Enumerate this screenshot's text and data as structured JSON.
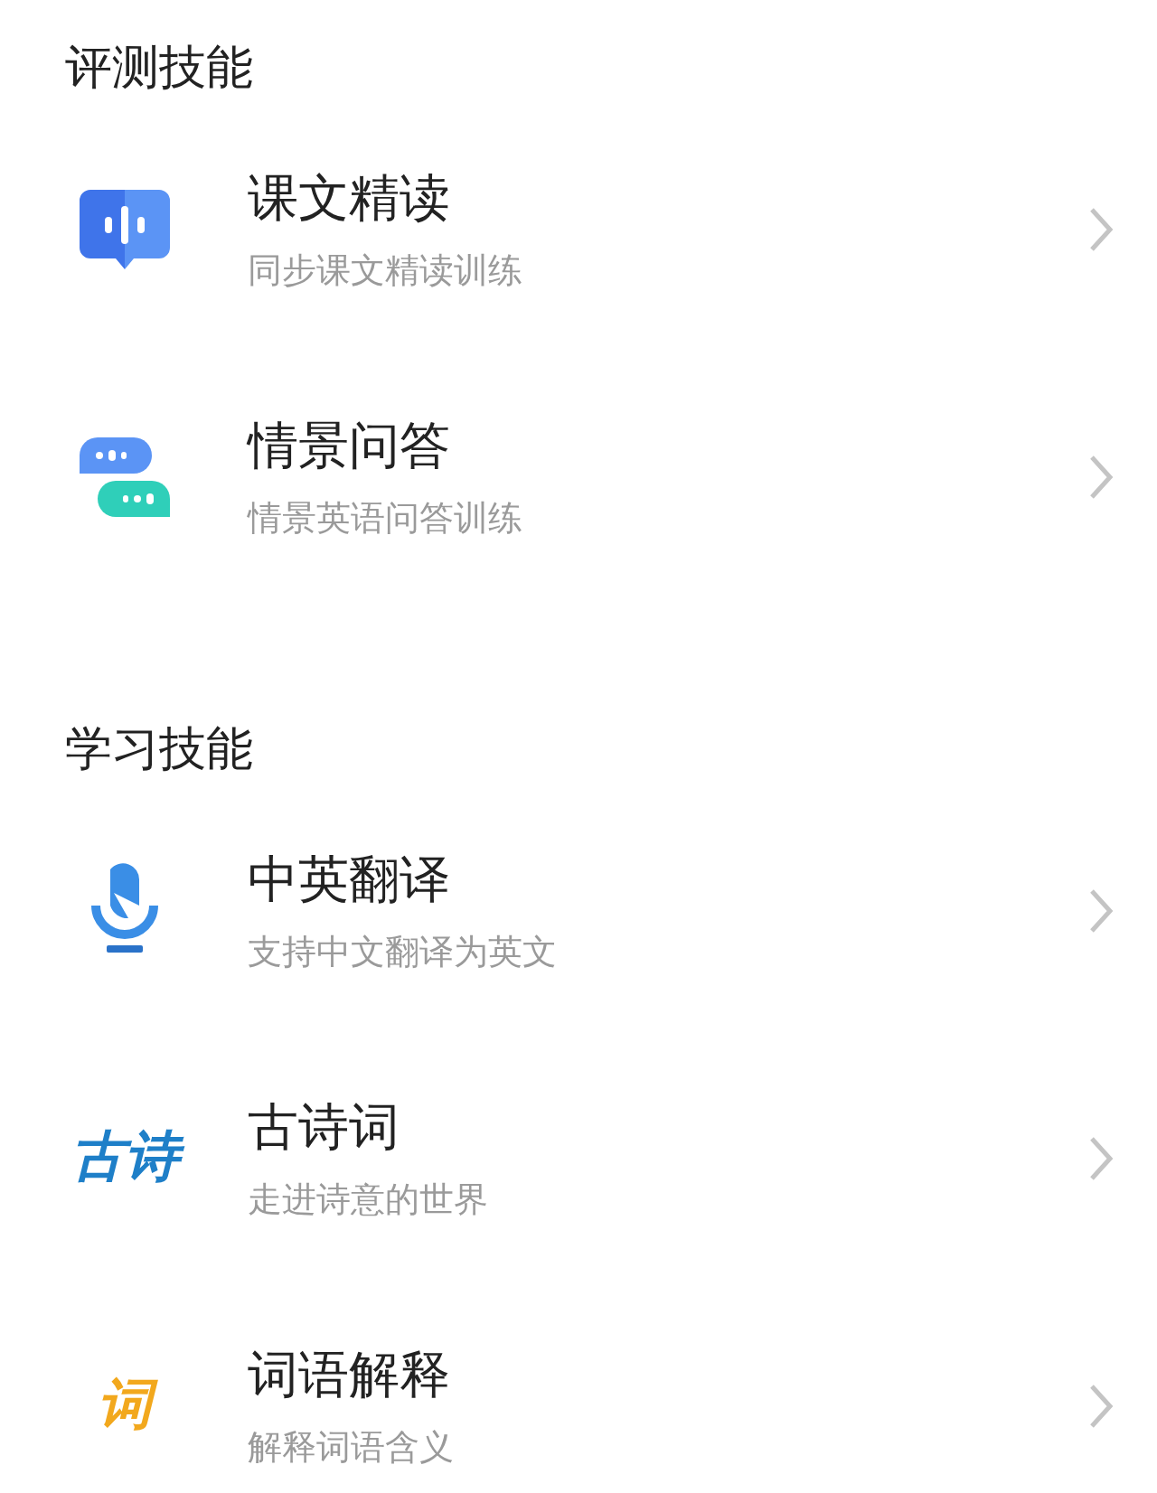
{
  "sections": [
    {
      "title": "评测技能",
      "items": [
        {
          "kind": "bubble",
          "title": "课文精读",
          "subtitle": "同步课文精读训练"
        },
        {
          "kind": "chat",
          "title": "情景问答",
          "subtitle": "情景英语问答训练"
        }
      ]
    },
    {
      "title": "学习技能",
      "items": [
        {
          "kind": "mic",
          "title": "中英翻译",
          "subtitle": "支持中文翻译为英文"
        },
        {
          "kind": "text",
          "icon_text": "古诗",
          "color": "#1e7fc8",
          "title": "古诗词",
          "subtitle": "走进诗意的世界"
        },
        {
          "kind": "text",
          "icon_text": "词",
          "color": "#f2a81d",
          "title": "词语解释",
          "subtitle": "解释词语含义"
        }
      ]
    }
  ]
}
